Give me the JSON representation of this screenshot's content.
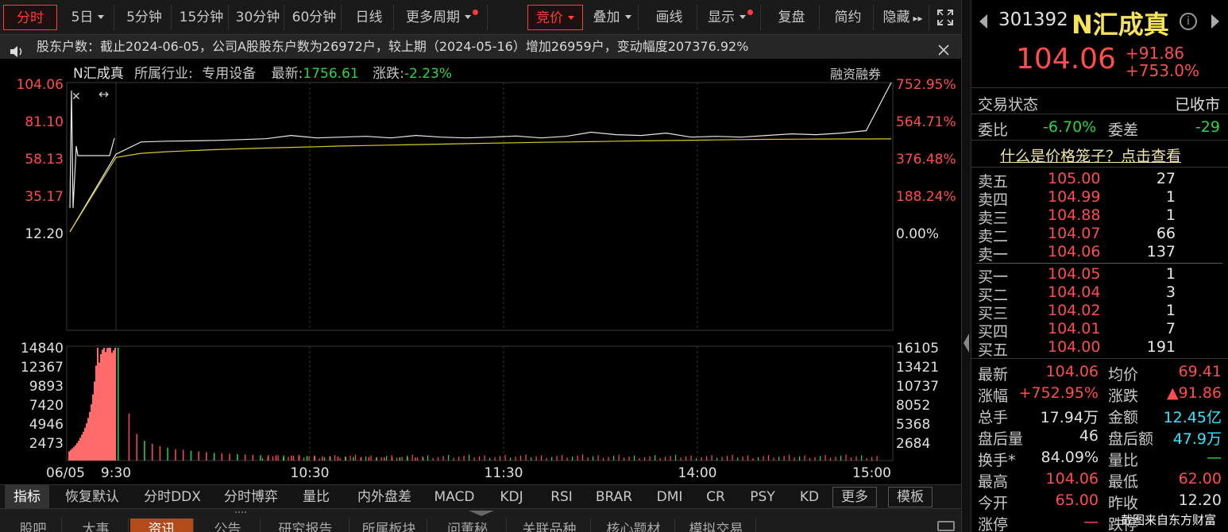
{
  "toolbar": {
    "items": [
      {
        "label": "分时",
        "active": true,
        "caret": false,
        "dot": false
      },
      {
        "label": "5日",
        "caret": true
      },
      {
        "label": "5分钟"
      },
      {
        "label": "15分钟"
      },
      {
        "label": "30分钟"
      },
      {
        "label": "60分钟"
      },
      {
        "label": "日线"
      },
      {
        "label": "更多周期",
        "caret": true,
        "dot": true
      },
      {
        "label": "竞价",
        "caret": true,
        "active": true
      },
      {
        "label": "叠加",
        "caret": true
      },
      {
        "label": "画线"
      },
      {
        "label": "显示",
        "caret": true,
        "dot": true
      },
      {
        "label": "复盘"
      },
      {
        "label": "简约"
      },
      {
        "label": "隐藏"
      }
    ]
  },
  "notice": {
    "text": "股东户数：截止2024-06-05，公司A股股东户数为26972户，较上期（2024-05-16）增加26959户，变动幅度207376.92%"
  },
  "chart_header": {
    "name": "N汇成真",
    "industry_label": "所属行业:",
    "industry": "专用设备",
    "latest_label": "最新:",
    "latest": "1756.61",
    "change_label": "涨跌:",
    "change": "-2.23%",
    "margin": "融资融券"
  },
  "chart_data": [
    {
      "type": "line",
      "series": [
        {
          "values": [
            12.2,
            60.0,
            67.5,
            68.0,
            68.2,
            68.5,
            69.0,
            69.5,
            71.5,
            70.0,
            70.5,
            71.0,
            70.0,
            71.5,
            70.5,
            70.0,
            70.5,
            71.2,
            70.0,
            71.0,
            73.5,
            72.0,
            71.5,
            73.0,
            70.5,
            71.0,
            70.5,
            71.5,
            72.5,
            72.0,
            73.0,
            74.5,
            104.06
          ]
        },
        {
          "values": [
            12.2,
            58.0,
            60.5,
            61.5,
            62.2,
            62.8,
            63.3,
            63.8,
            64.2,
            64.6,
            65.0,
            65.3,
            65.6,
            65.9,
            66.2,
            66.5,
            66.8,
            67.0,
            67.3,
            67.5,
            67.7,
            68.0,
            68.2,
            68.4,
            68.6,
            68.8,
            69.0,
            69.1,
            69.2,
            69.3,
            69.35,
            69.38,
            69.41
          ]
        }
      ],
      "left_ticks": [
        "104.06",
        "81.10",
        "58.13",
        "35.17",
        "12.20"
      ],
      "right_ticks": [
        "752.95%",
        "564.71%",
        "376.48%",
        "188.24%",
        "0.00%"
      ],
      "ylim": [
        12.2,
        104.06
      ]
    },
    {
      "type": "bar",
      "left_ticks": [
        "14840",
        "12367",
        "9893",
        "7420",
        "4946",
        "2473"
      ],
      "right_ticks": [
        "16105",
        "13421",
        "10737",
        "8052",
        "5368",
        "2684"
      ],
      "x_ticks": [
        "06/05",
        "9:30",
        "10:30",
        "11:30",
        "14:00",
        "15:00"
      ],
      "auction_values": [
        1200,
        1400,
        1600,
        1800,
        2000,
        2300,
        2600,
        3000,
        3400,
        3800,
        4300,
        4900,
        5600,
        6400,
        7400,
        8700,
        10400,
        12500,
        14840,
        12900,
        14000,
        14600,
        14840,
        14300,
        14800,
        14840,
        14840,
        14200,
        14500,
        14840
      ],
      "values": [
        14840,
        6200,
        3500,
        2600,
        2200,
        1900,
        1700,
        1500,
        1400,
        1300,
        1200,
        1100,
        1000,
        950,
        900,
        850,
        800,
        760,
        720,
        700,
        680,
        660,
        640,
        620,
        600,
        580,
        560,
        540,
        520,
        500,
        480,
        470,
        460,
        450,
        440,
        430,
        420,
        410,
        400,
        390
      ]
    }
  ],
  "indicators": {
    "items": [
      "指标",
      "恢复默认",
      "分时DDX",
      "分时博弈",
      "量比",
      "内外盘差",
      "MACD",
      "KDJ",
      "RSI",
      "BRAR",
      "DMI",
      "CR",
      "PSY",
      "KD",
      "更多",
      "模板"
    ]
  },
  "tabs": {
    "items": [
      "股吧",
      "大事",
      "资讯",
      "公告",
      "研究报告",
      "所属板块",
      "问董秘",
      "关联品种",
      "核心题材",
      "模拟交易"
    ]
  },
  "quote": {
    "code": "301392",
    "name": "N汇成真",
    "price": "104.06",
    "change": "+91.86",
    "change_pct": "+753.0%",
    "status_label": "交易状态",
    "status": "已收市",
    "wb_label": "委比",
    "wb": "-6.70%",
    "wc_label": "委差",
    "wc": "-29",
    "cage_link": "什么是价格笼子？点击查看",
    "asks": [
      {
        "label": "卖五",
        "price": "105.00",
        "vol": "27"
      },
      {
        "label": "卖四",
        "price": "104.99",
        "vol": "1"
      },
      {
        "label": "卖三",
        "price": "104.88",
        "vol": "1"
      },
      {
        "label": "卖二",
        "price": "104.07",
        "vol": "66"
      },
      {
        "label": "卖一",
        "price": "104.06",
        "vol": "137"
      }
    ],
    "bids": [
      {
        "label": "买一",
        "price": "104.05",
        "vol": "1"
      },
      {
        "label": "买二",
        "price": "104.04",
        "vol": "3"
      },
      {
        "label": "买三",
        "price": "104.02",
        "vol": "1"
      },
      {
        "label": "买四",
        "price": "104.01",
        "vol": "7"
      },
      {
        "label": "买五",
        "price": "104.00",
        "vol": "191"
      }
    ],
    "stats": [
      {
        "l1": "最新",
        "v1": "104.06",
        "c1": "red",
        "l2": "均价",
        "v2": "69.41",
        "c2": "red"
      },
      {
        "l1": "涨幅",
        "v1": "+752.95%",
        "c1": "red",
        "l2": "涨跌",
        "v2": "▲91.86",
        "c2": "red"
      },
      {
        "l1": "总手",
        "v1": "17.94万",
        "c1": "white",
        "l2": "金额",
        "v2": "12.45亿",
        "c2": "cyan"
      },
      {
        "l1": "盘后量",
        "v1": "46",
        "c1": "white",
        "l2": "盘后额",
        "v2": "47.9万",
        "c2": "cyan"
      },
      {
        "l1": "换手*",
        "v1": "84.09%",
        "c1": "white",
        "l2": "量比",
        "v2": "—",
        "c2": "green"
      },
      {
        "l1": "最高",
        "v1": "104.06",
        "c1": "red",
        "l2": "最低",
        "v2": "62.00",
        "c2": "red"
      },
      {
        "l1": "今开",
        "v1": "65.00",
        "c1": "red",
        "l2": "昨收",
        "v2": "12.20",
        "c2": "white"
      },
      {
        "l1": "涨停",
        "v1": "—",
        "c1": "red",
        "l2": "跌停",
        "v2": "",
        "c2": "white"
      }
    ],
    "watermark": "截图来自东方财富"
  }
}
